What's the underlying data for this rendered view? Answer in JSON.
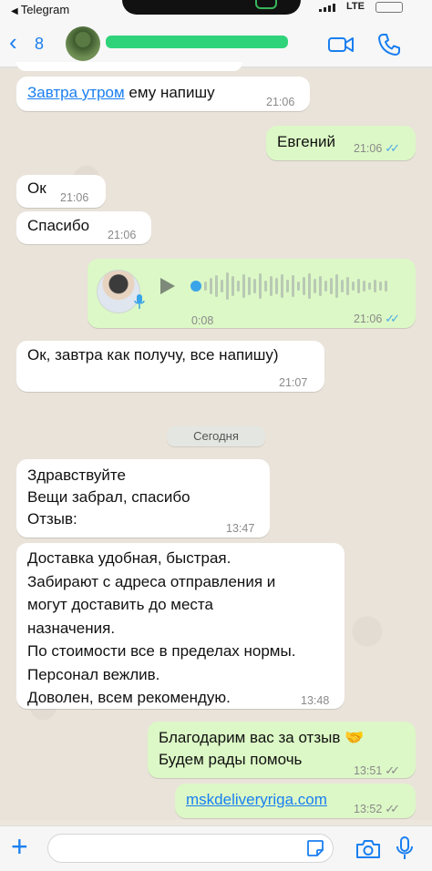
{
  "status_bar": {
    "back_to_app": "Telegram",
    "network": "LTE"
  },
  "header": {
    "unread_count": "8"
  },
  "messages": [
    {
      "dir": "in",
      "text_link": "Завтра утром",
      "text_rest": " ему напишу",
      "time": "21:06"
    },
    {
      "dir": "out",
      "text": "Евгений",
      "time": "21:06",
      "status": "read"
    },
    {
      "dir": "in",
      "text": "Ок",
      "time": "21:06"
    },
    {
      "dir": "in",
      "text": "Спасибо",
      "time": "21:06"
    },
    {
      "dir": "out",
      "type": "voice",
      "duration": "0:08",
      "time": "21:06",
      "status": "read"
    },
    {
      "dir": "in",
      "text": "Ок, завтра как получу, все напишу)",
      "time": "21:07"
    },
    {
      "type": "date_separator",
      "text": "Сегодня"
    },
    {
      "dir": "in",
      "lines": [
        "Здравствуйте",
        "Вещи забрал, спасибо",
        "Отзыв:"
      ],
      "time": "13:47"
    },
    {
      "dir": "in",
      "lines": [
        "Доставка удобная, быстрая.",
        "Забирают с адреса отправления и",
        "могут доставить до места",
        "назначения.",
        "По стоимости все в пределах нормы.",
        "Персонал вежлив.",
        "Доволен, всем рекомендую."
      ],
      "time": "13:48"
    },
    {
      "dir": "out",
      "lines": [
        "Благодарим вас за отзыв 🤝",
        "Будем рады помочь"
      ],
      "time": "13:51",
      "status": "delivered"
    },
    {
      "dir": "out",
      "link": "mskdeliveryriga.com",
      "time": "13:52",
      "status": "delivered"
    }
  ],
  "colors": {
    "accent": "#1a7ff0",
    "outgoing_bubble": "#dcf8c6",
    "incoming_bubble": "#ffffff",
    "read_ticks": "#4fa9e6",
    "wallpaper": "#e9e3da"
  },
  "icons": {
    "back": "chevron-left-icon",
    "video": "video-camera-icon",
    "call": "phone-icon",
    "attach": "plus-icon",
    "sticker": "sticker-icon",
    "camera": "camera-icon",
    "mic": "microphone-icon"
  }
}
